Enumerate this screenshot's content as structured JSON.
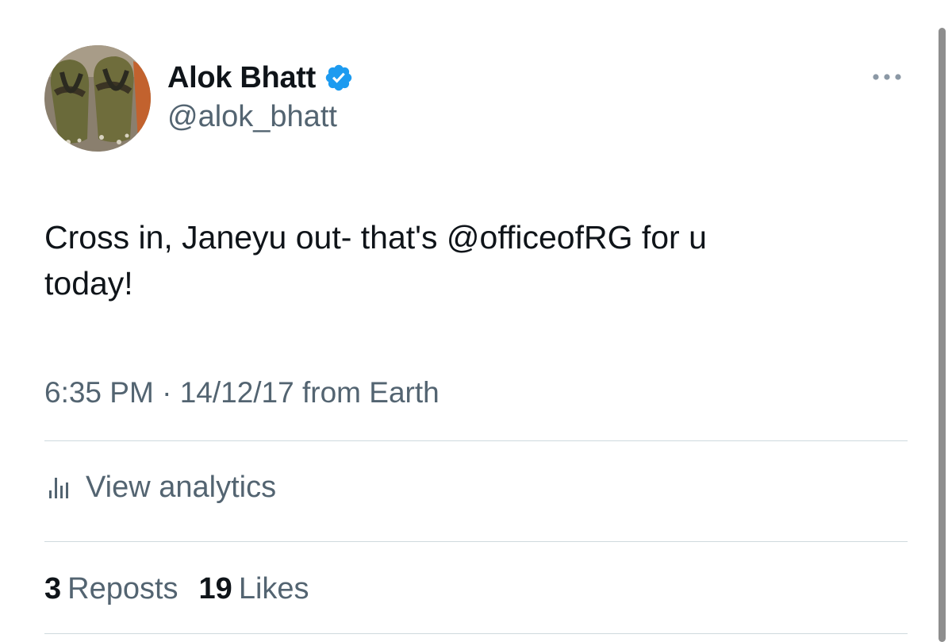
{
  "tweet": {
    "author": {
      "display_name": "Alok Bhatt",
      "handle": "@alok_bhatt",
      "verified": true,
      "avatar_icon": "sandals-photo"
    },
    "text_line1": "Cross in, Janeyu out- that's @officeofRG for u",
    "text_line2": "today!",
    "time": "6:35 PM",
    "separator": "·",
    "date": "14/12/17",
    "source": "from Earth",
    "analytics_label": "View analytics",
    "reposts_count": "3",
    "reposts_label": "Reposts",
    "likes_count": "19",
    "likes_label": "Likes"
  },
  "colors": {
    "text_primary": "#0f1419",
    "text_secondary": "#536471",
    "verified_blue": "#1d9bf0",
    "divider": "#cfd9de"
  }
}
